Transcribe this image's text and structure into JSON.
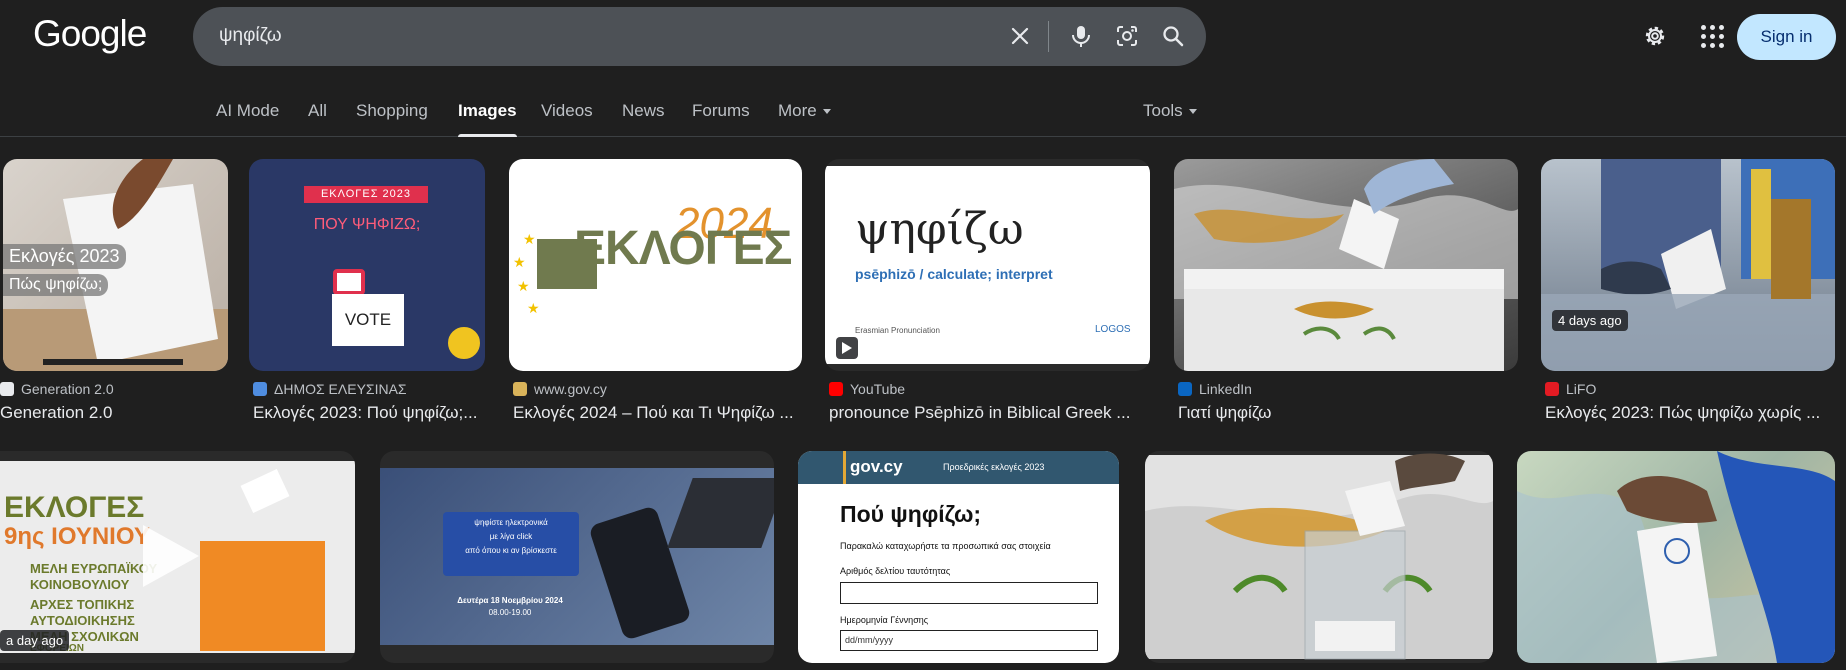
{
  "header": {
    "logo": "Google",
    "search_value": "ψηφίζω",
    "signin_label": "Sign in"
  },
  "icons": {
    "clear": "close-icon",
    "voice": "microphone-icon",
    "lens": "lens-camera-icon",
    "search": "search-icon",
    "settings": "gear-icon",
    "apps": "apps-grid-icon"
  },
  "tabs": [
    {
      "label": "AI Mode"
    },
    {
      "label": "All"
    },
    {
      "label": "Shopping"
    },
    {
      "label": "Images"
    },
    {
      "label": "Videos"
    },
    {
      "label": "News"
    },
    {
      "label": "Forums"
    },
    {
      "label": "More"
    }
  ],
  "tools_label": "Tools",
  "colors": {
    "background": "#1f1f1f",
    "searchbox": "#4d5156",
    "signin_bg": "#c2e7ff",
    "signin_text": "#062e6f"
  },
  "results": [
    {
      "source": "Generation 2.0",
      "title": "Generation 2.0",
      "thumb_lines": [
        "Εκλογές 2023",
        "Πώς ψηφίζω;"
      ]
    },
    {
      "source": "ΔΗΜΟΣ ΕΛΕΥΣΙΝΑΣ",
      "title": "Εκλογές 2023: Πού ψηφίζω;...",
      "thumb_lines": [
        "ΕΚΛΟΓΕΣ 2023",
        "ΠΟΥ ΨΗΦΙΖΩ;",
        "VOTE"
      ]
    },
    {
      "source": "www.gov.cy",
      "title": "Εκλογές 2024 – Πού και Τι Ψηφίζω ...",
      "thumb_lines": [
        "2024",
        "ΕΚΛΟΓΕΣ"
      ]
    },
    {
      "source": "YouTube",
      "title": "pronounce Psēphizō in Biblical Greek ...",
      "thumb_lines": [
        "ψηφίζω",
        "psēphizō / calculate; interpret",
        "Erasmian Pronunciation",
        "LOGOS"
      ]
    },
    {
      "source": "LinkedIn",
      "title": "Γιατί ψηφίζω",
      "thumb_lines": []
    },
    {
      "source": "LiFO",
      "title": "Εκλογές 2023: Πώς ψηφίζω χωρίς ...",
      "badge": "4 days ago",
      "thumb_lines": []
    },
    {
      "badge": "a day ago",
      "thumb_lines": [
        "ΕΚΛΟΓΕΣ",
        "9ης ΙΟΥΝΙΟΥ",
        "ΜΕΛΗ ΕΥΡΩΠΑΪΚΟΥ",
        "ΚΟΙΝΟΒΟΥΛΙΟΥ",
        "ΑΡΧΕΣ ΤΟΠΙΚΗΣ",
        "ΑΥΤΟΔΙΟΙΚΗΣΗΣ",
        "ΜΕΛΗ ΣΧΟΛΙΚΩΝ",
        "ΕΦΟΡΕΙΩΝ"
      ]
    },
    {
      "thumb_lines": [
        "ψηφίστε ηλεκτρονικά",
        "με λίγα click",
        "από όπου κι αν βρίσκεστε",
        "Δευτέρα 18 Νοεμβρίου 2024",
        "08.00-19.00"
      ]
    },
    {
      "thumb_lines": [
        "gov.cy",
        "Προεδρικές εκλογές 2023",
        "Πού ψηφίζω;",
        "Παρακαλώ καταχωρήστε τα προσωπικά σας στοιχεία",
        "Αριθμός δελτίου ταυτότητας",
        "Ημερομηνία Γέννησης",
        "dd/mm/yyyy"
      ]
    },
    {
      "thumb_lines": []
    },
    {
      "thumb_lines": []
    }
  ]
}
